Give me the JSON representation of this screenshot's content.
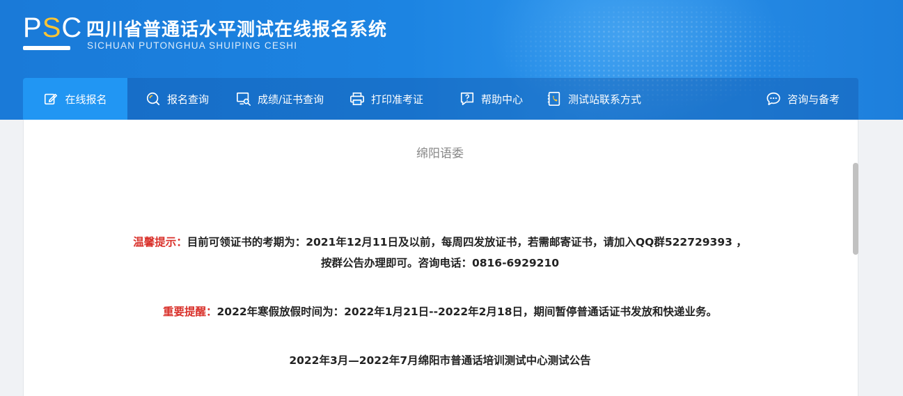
{
  "header": {
    "logo": "PSC",
    "title": "四川省普通话水平测试在线报名系统",
    "subtitle": "SICHUAN PUTONGHUA SHUIPING CESHI"
  },
  "nav": {
    "items": [
      {
        "label": "在线报名",
        "icon": "edit-icon",
        "active": true
      },
      {
        "label": "报名查询",
        "icon": "search-circle-icon"
      },
      {
        "label": "成绩/证书查询",
        "icon": "monitor-search-icon"
      },
      {
        "label": "打印准考证",
        "icon": "printer-icon"
      },
      {
        "label": "帮助中心",
        "icon": "help-icon"
      },
      {
        "label": "测试站联系方式",
        "icon": "phone-book-icon"
      },
      {
        "label": "咨询与备考",
        "icon": "chat-icon"
      }
    ]
  },
  "content": {
    "org_title": "绵阳语委",
    "notice1_label": "温馨提示：",
    "notice1_text": "目前可领证书的考期为：2021年12月11日及以前，每周四发放证书，若需邮寄证书，请加入QQ群522729393 ，按群公告办理即可。咨询电话：0816-6929210",
    "notice2_label": "重要提醒：",
    "notice2_text": "2022年寒假放假时间为：2022年1月21日--2022年2月18日，期间暂停普通话证书发放和快递业务。",
    "notice3_text": "2022年3月—2022年7月绵阳市普通话培训测试中心测试公告"
  },
  "colors": {
    "header_blue": "#1c84e2",
    "active_tab": "#2196f3",
    "alert_red": "#d9312b",
    "logo_accent": "#ffc533"
  }
}
